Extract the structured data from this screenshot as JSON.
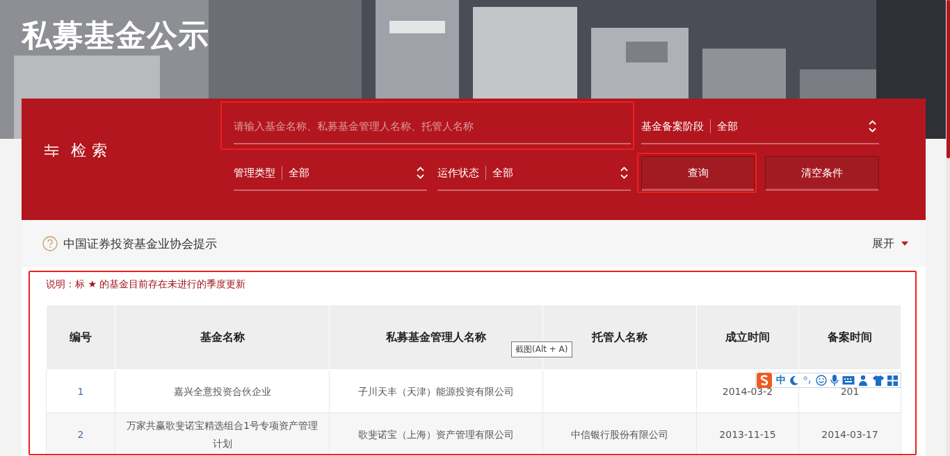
{
  "header": {
    "title": "私募基金公示"
  },
  "search": {
    "heading": "检索",
    "keyword": {
      "placeholder": "请输入基金名称、私募基金管理人名称、托管人名称"
    },
    "filters": [
      {
        "label": "基金备案阶段",
        "value": "全部"
      },
      {
        "label": "管理类型",
        "value": "全部"
      },
      {
        "label": "运作状态",
        "value": "全部"
      }
    ],
    "buttons": [
      "查询",
      "清空条件"
    ]
  },
  "notice": {
    "title": "中国证券投资基金业协会提示",
    "toggle": "展开"
  },
  "legend": "说明：标 ★ 的基金目前存在未进行的季度更新",
  "table": {
    "columns": [
      "编号",
      "基金名称",
      "私募基金管理人名称",
      "托管人名称",
      "成立时间",
      "备案时间"
    ],
    "rows": [
      {
        "number": "1",
        "fund": "嘉兴全意投资合伙企业",
        "manager": "子川天丰（天津）能源投资有限公司",
        "established": "2014-03-2",
        "filed": "201"
      },
      {
        "number": "2",
        "fund": "万家共赢歌斐诺宝精选组合1号专项资产管理计划",
        "manager": "歌斐诺宝（上海）资产管理有限公司",
        "custodian": "中信银行股份有限公司",
        "established": "2013-11-15",
        "filed": "2014-03-17"
      }
    ]
  },
  "tooltip": "截图(Alt + A)",
  "ime_toolbar": {
    "mode": "中"
  }
}
